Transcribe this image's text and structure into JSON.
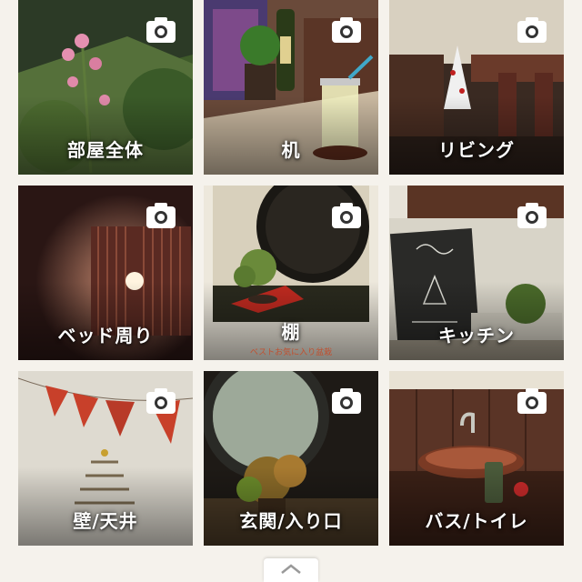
{
  "categories": [
    {
      "label": "部屋全体",
      "icon": "camera-icon"
    },
    {
      "label": "机",
      "icon": "camera-icon"
    },
    {
      "label": "リビング",
      "icon": "camera-icon"
    },
    {
      "label": "ベッド周り",
      "icon": "camera-icon"
    },
    {
      "label": "棚",
      "icon": "camera-icon",
      "photo_caption": "ベストお気に入り盆栽"
    },
    {
      "label": "キッチン",
      "icon": "camera-icon"
    },
    {
      "label": "壁/天井",
      "icon": "camera-icon"
    },
    {
      "label": "玄関/入り口",
      "icon": "camera-icon"
    },
    {
      "label": "バス/トイレ",
      "icon": "camera-icon"
    }
  ],
  "footer": {
    "handle_icon": "chevron-up-icon"
  },
  "colors": {
    "background": "#f5f2ec",
    "label_text": "#ffffff"
  }
}
